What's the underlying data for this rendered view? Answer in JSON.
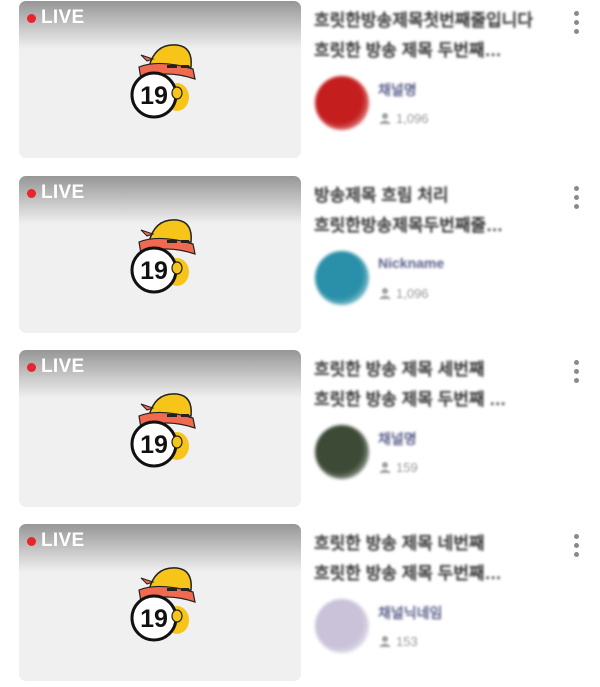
{
  "colors": {
    "live_dot": "#e8242c",
    "thumbnail_bg": "#f0f0f0",
    "mascot_hat": "#f7c51a",
    "mascot_scarf": "#ef6a50",
    "channel_name": "#5a5f8a"
  },
  "icons": {
    "live": "red-dot-icon",
    "age_restriction": "age-19-mascot-icon",
    "viewers": "viewer-icon",
    "more": "vertical-ellipsis-icon"
  },
  "streams": [
    {
      "live_label": "LIVE",
      "age_label": "19",
      "title_line1": "흐릿한방송제목첫번째줄입니다",
      "title_line2": "흐릿한 방송 제목 두번째…",
      "channel_name": "채널명",
      "viewer_count": "1,096",
      "avatar_color": "#c41e1e"
    },
    {
      "live_label": "LIVE",
      "age_label": "19",
      "title_line1": "방송제목 흐림 처리",
      "title_line2": "흐릿한방송제목두번째줄…",
      "channel_name": "Nickname",
      "viewer_count": "1,096",
      "avatar_color": "#2a8fa8"
    },
    {
      "live_label": "LIVE",
      "age_label": "19",
      "title_line1": "흐릿한 방송 제목 세번째",
      "title_line2": "흐릿한 방송 제목 두번째 …",
      "channel_name": "채널명",
      "viewer_count": "159",
      "avatar_color": "#3c4a36"
    },
    {
      "live_label": "LIVE",
      "age_label": "19",
      "title_line1": "흐릿한 방송 제목 네번째",
      "title_line2": "흐릿한 방송 제목 두번째…",
      "channel_name": "채널닉네임",
      "viewer_count": "153",
      "avatar_color": "#c9c2d8"
    }
  ]
}
